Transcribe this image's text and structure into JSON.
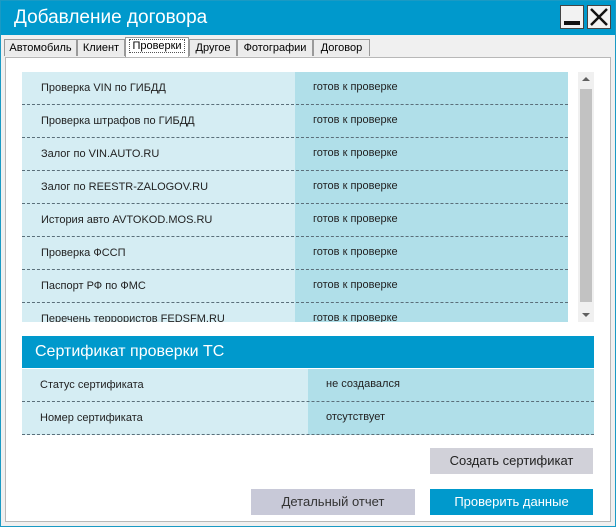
{
  "window": {
    "title": "Добавление договора"
  },
  "tabs": [
    {
      "label": "Автомобиль"
    },
    {
      "label": "Клиент"
    },
    {
      "label": "Проверки",
      "active": true
    },
    {
      "label": "Другое"
    },
    {
      "label": "Фотографии"
    },
    {
      "label": "Договор"
    }
  ],
  "checks": [
    {
      "label": "Проверка VIN по ГИБДД",
      "status": "готов к проверке"
    },
    {
      "label": "Проверка штрафов по ГИБДД",
      "status": "готов к проверке"
    },
    {
      "label": "Залог по VIN.AUTO.RU",
      "status": "готов к проверке"
    },
    {
      "label": "Залог по REESTR-ZALOGOV.RU",
      "status": "готов к проверке"
    },
    {
      "label": "История авто AVTOKOD.MOS.RU",
      "status": "готов к проверке"
    },
    {
      "label": "Проверка ФССП",
      "status": "готов к проверке"
    },
    {
      "label": "Паспорт РФ по ФМС",
      "status": "готов к проверке"
    },
    {
      "label": "Перечень террористов FEDSFM.RU",
      "status": "готов к проверке"
    }
  ],
  "certificate": {
    "title": "Сертификат проверки ТС",
    "rows": [
      {
        "label": "Статус сертификата",
        "value": "не создавался"
      },
      {
        "label": "Номер сертификата",
        "value": "отсутствует"
      }
    ]
  },
  "buttons": {
    "create_certificate": "Создать сертификат",
    "detailed_report": "Детальный отчет",
    "check_data": "Проверить данные"
  },
  "colors": {
    "accent": "#0099cc",
    "row_light": "#d5edf3",
    "row_dark": "#b0dfe9"
  }
}
